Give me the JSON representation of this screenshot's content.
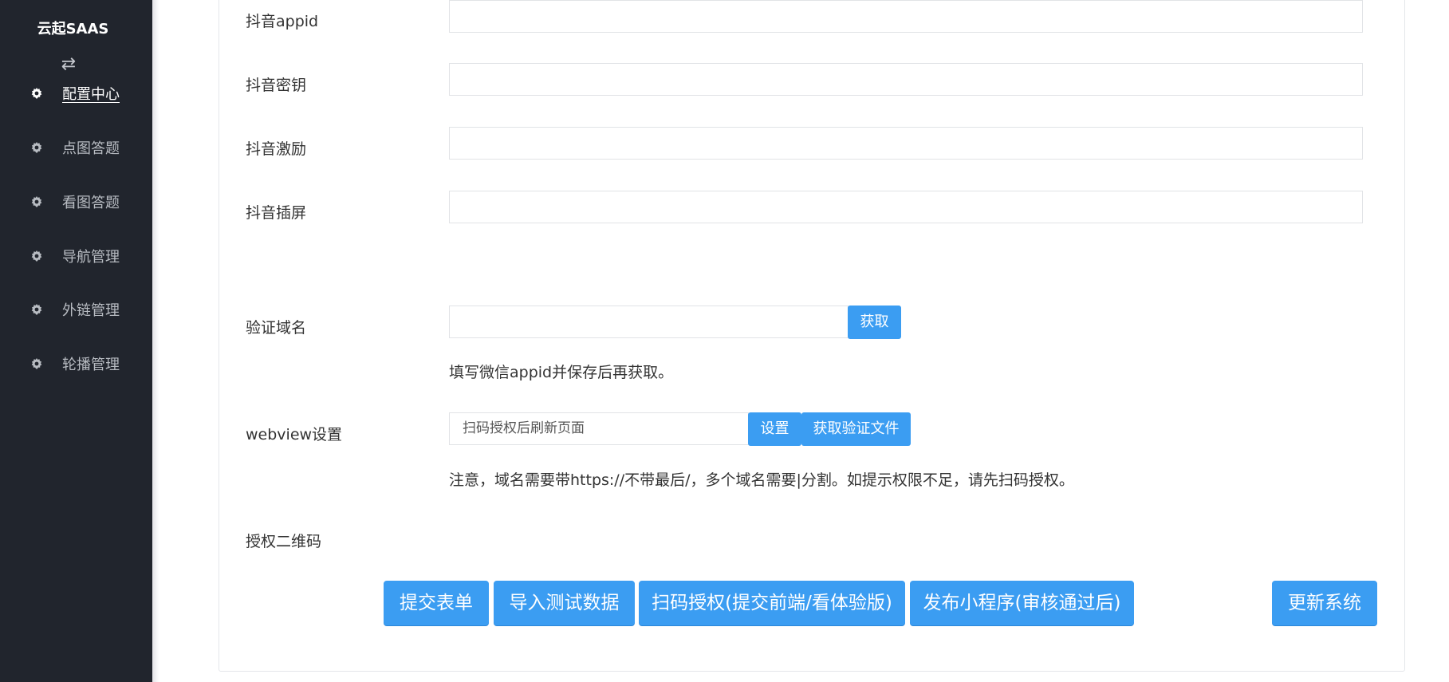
{
  "sidebar": {
    "brand": "云起SAAS",
    "items": [
      {
        "label": "配置中心",
        "active": true
      },
      {
        "label": "点图答题"
      },
      {
        "label": "看图答题"
      },
      {
        "label": "导航管理"
      },
      {
        "label": "外链管理"
      },
      {
        "label": "轮播管理"
      }
    ]
  },
  "form": {
    "douyin_appid_label": "抖音appid",
    "douyin_secret_label": "抖音密钥",
    "douyin_reward_label": "抖音激励",
    "douyin_interstitial_label": "抖音插屏",
    "verify_domain_label": "验证域名",
    "fetch_button": "获取",
    "verify_help": "填写微信appid并保存后再获取。",
    "webview_label": "webview设置",
    "webview_value": "扫码授权后刷新页面",
    "set_button": "设置",
    "get_verify_file_button": "获取验证文件",
    "webview_help": "注意，域名需要带https://不带最后/，多个域名需要|分割。如提示权限不足，请先扫码授权。",
    "qrcode_label": "授权二维码"
  },
  "actions": {
    "submit": "提交表单",
    "import_test": "导入测试数据",
    "scan_auth": "扫码授权(提交前端/看体验版)",
    "publish": "发布小程序(审核通过后)",
    "update": "更新系统"
  },
  "colors": {
    "sidebar_bg": "#21252d",
    "accent": "#3b9df2"
  }
}
